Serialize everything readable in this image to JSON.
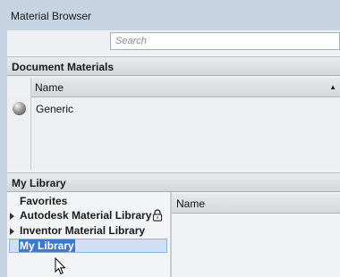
{
  "window": {
    "title": "Material Browser"
  },
  "search": {
    "placeholder": "Search"
  },
  "document_materials": {
    "header": "Document Materials",
    "column_name": "Name",
    "rows": [
      {
        "label": "Generic",
        "icon": "material-sphere-icon"
      }
    ]
  },
  "my_library": {
    "header": "My Library",
    "tree": [
      {
        "label": "Favorites",
        "expandable": false
      },
      {
        "label": "Autodesk Material Library",
        "expandable": true,
        "locked": true
      },
      {
        "label": "Inventor Material Library",
        "expandable": true
      },
      {
        "label": "My Library",
        "expandable": false,
        "selected": true
      }
    ],
    "content_column_name": "Name"
  },
  "colors": {
    "selection": "#3a79cf",
    "frame": "#c5d3e2"
  }
}
